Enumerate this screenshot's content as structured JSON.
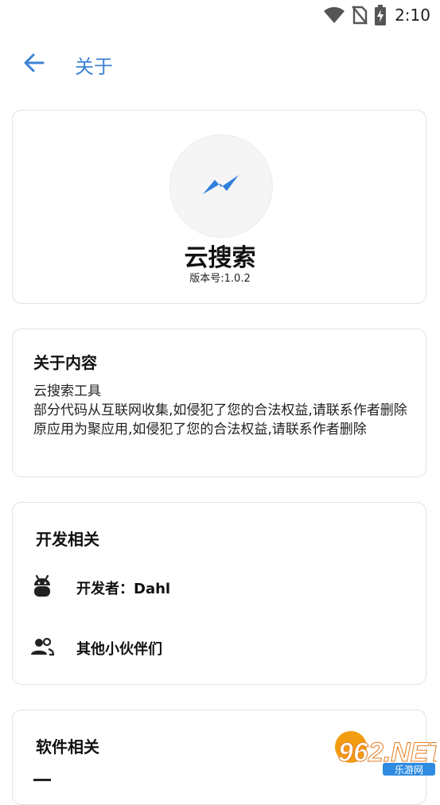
{
  "status_bar": {
    "time": "2:10",
    "icons": [
      "wifi-icon",
      "no-sim-icon",
      "battery-charging-icon"
    ]
  },
  "app_bar": {
    "title": "关于",
    "back_icon": "arrow-back-icon"
  },
  "app_info": {
    "name": "云搜索",
    "version": "版本号:1.0.2",
    "logo_icon": "lightning-bolt-icon"
  },
  "about": {
    "title": "关于内容",
    "lines": [
      "云搜索工具",
      "部分代码从互联网收集,如侵犯了您的合法权益,请联系作者删除",
      "原应用为聚应用,如侵犯了您的合法权益,请联系作者删除"
    ]
  },
  "developer": {
    "title": "开发相关",
    "items": [
      {
        "label": "开发者：Dahl",
        "icon": "android-icon"
      },
      {
        "label": "其他小伙伴们",
        "icon": "people-icon"
      }
    ]
  },
  "software": {
    "title": "软件相关"
  },
  "watermark": {
    "main": "962.NET",
    "sub": "乐游网"
  },
  "colors": {
    "accent": "#3b82d6",
    "card_border": "#e3e3e3",
    "text": "#111111"
  }
}
